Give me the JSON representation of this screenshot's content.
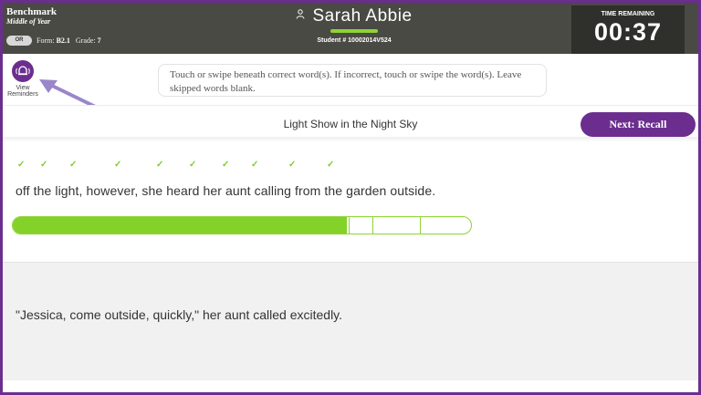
{
  "header": {
    "assessment_title": "Benchmark",
    "period": "Middle of Year",
    "toggle_label": "OR",
    "form_label": "Form:",
    "form_value": "B2.1",
    "grade_label": "Grade:",
    "grade_value": "7",
    "student_name": "Sarah Abbie",
    "student_id": "Student # 10002014V524",
    "timer_label": "TIME REMAINING",
    "timer_value": "00:37",
    "colors": {
      "header_bg": "#4a4a44",
      "accent": "#6b2e8e",
      "progress": "#84d12a"
    }
  },
  "reminders": {
    "label_line1": "View",
    "label_line2": "Reminders",
    "icon": "bell-icon"
  },
  "instructions": "Touch or swipe beneath correct word(s). If incorrect, touch or swipe the word(s). Leave skipped words blank.",
  "story": {
    "title": "Light Show in the Night Sky",
    "next_button": "Next: Recall"
  },
  "passage": {
    "current_line": "off the light, however, she heard her aunt calling from the garden outside.",
    "checked_words": 10,
    "next_line": "\"Jessica, come outside, quickly,\" her aunt called excitedly."
  },
  "progress": {
    "fraction": 0.73,
    "segments": 4
  }
}
